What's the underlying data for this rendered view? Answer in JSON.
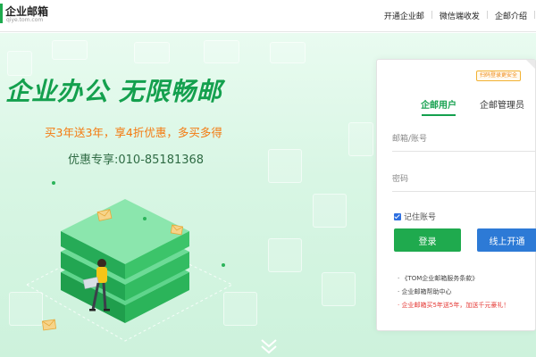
{
  "header": {
    "logo_title": "企业邮箱",
    "logo_sub": "qiye.tom.com",
    "nav": [
      "开通企业邮",
      "微信端收发",
      "企邮介绍"
    ]
  },
  "hero": {
    "headline": "企业办公  无限畅邮",
    "promo": "买3年送3年，享4折优惠，多买多得",
    "hotline": "优惠专享:010-85181368"
  },
  "login": {
    "scan_badge": "扫码登录更安全",
    "tabs": [
      "企邮用户",
      "企邮管理员"
    ],
    "account_placeholder": "邮箱/账号",
    "password_placeholder": "密码",
    "remember_label": "记住账号",
    "login_button": "登录",
    "open_button": "线上开通",
    "links": [
      "《TOM企业邮箱服务条款》",
      "企业邮箱帮助中心",
      "企业邮箱买5年送5年，加送千元豪礼！"
    ]
  },
  "colors": {
    "brand_green": "#14a04e",
    "promo_orange": "#f47a10",
    "button_blue": "#2d7ad6",
    "alert_red": "#e53935"
  },
  "icons": [
    "envelope-icon",
    "chevron-down-icon",
    "checkbox-icon"
  ]
}
